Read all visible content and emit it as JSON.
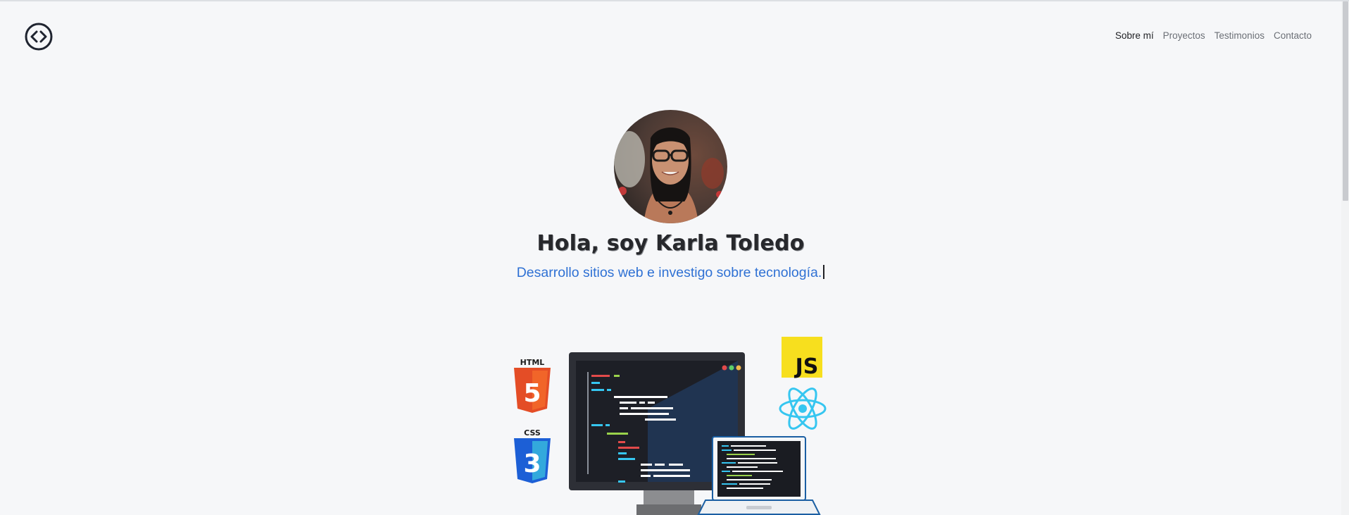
{
  "header": {
    "nav": [
      {
        "label": "Sobre mí",
        "active": true
      },
      {
        "label": "Proyectos",
        "active": false
      },
      {
        "label": "Testimonios",
        "active": false
      },
      {
        "label": "Contacto",
        "active": false
      }
    ]
  },
  "hero": {
    "title": "Hola, soy Karla Toledo",
    "subtitle": "Desarrollo sitios web e investigo sobre tecnología."
  },
  "illustration": {
    "html_badge": "HTML",
    "html_digit": "5",
    "css_badge": "CSS",
    "css_digit": "3",
    "js_badge": "JS"
  },
  "colors": {
    "accent": "#2f71d4",
    "html": "#e44d26",
    "css": "#1c5fd6",
    "js": "#f7df1e",
    "react": "#36c6f0"
  }
}
